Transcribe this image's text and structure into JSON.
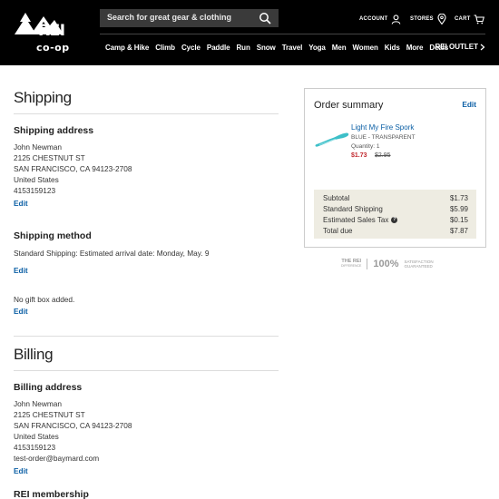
{
  "header": {
    "logo_text": "REI CO-OP",
    "search_placeholder": "Search for great gear & clothing",
    "account_label": "ACCOUNT",
    "stores_label": "STORES",
    "cart_label": "CART",
    "nav": [
      "Camp & Hike",
      "Climb",
      "Cycle",
      "Paddle",
      "Run",
      "Snow",
      "Travel",
      "Yoga",
      "Men",
      "Women",
      "Kids",
      "More",
      "Deals"
    ],
    "outlet_label": "REI OUTLET"
  },
  "shipping": {
    "title": "Shipping",
    "address_heading": "Shipping address",
    "address_lines": [
      "John Newman",
      "2125 CHESTNUT ST",
      "SAN FRANCISCO, CA 94123-2708",
      "United States",
      "4153159123"
    ],
    "address_edit": "Edit",
    "method_heading": "Shipping method",
    "method_text": "Standard Shipping: Estimated arrival date: Monday, May. 9",
    "method_edit": "Edit",
    "gift_text": "No gift box added.",
    "gift_edit": "Edit"
  },
  "billing": {
    "title": "Billing",
    "address_heading": "Billing address",
    "address_lines": [
      "John Newman",
      "2125 CHESTNUT ST",
      "SAN FRANCISCO, CA 94123-2708",
      "United States",
      "4153159123",
      "test-order@baymard.com"
    ],
    "address_edit": "Edit",
    "membership_heading": "REI membership"
  },
  "summary": {
    "title": "Order summary",
    "edit": "Edit",
    "item": {
      "name": "Light My Fire Spork",
      "variant": "BLUE - TRANSPARENT",
      "quantity": "Quantity: 1",
      "price": "$1.73",
      "was_price": "$2.95"
    },
    "totals": [
      {
        "label": "Subtotal",
        "value": "$1.73"
      },
      {
        "label": "Standard Shipping",
        "value": "$5.99"
      },
      {
        "label": "Estimated Sales Tax",
        "value": "$0.15"
      },
      {
        "label": "Total due",
        "value": "$7.87"
      }
    ]
  },
  "guarantee": {
    "left_top": "THE REI",
    "left_bottom": "DIFFERENCE",
    "big": "100%",
    "right_top": "SATISFACTION",
    "right_bottom": "GUARANTEED"
  },
  "colors": {
    "header_bg": "#000000",
    "link": "#0b5fa5",
    "sale_price": "#c0272d",
    "totals_bg": "#eeece2"
  }
}
